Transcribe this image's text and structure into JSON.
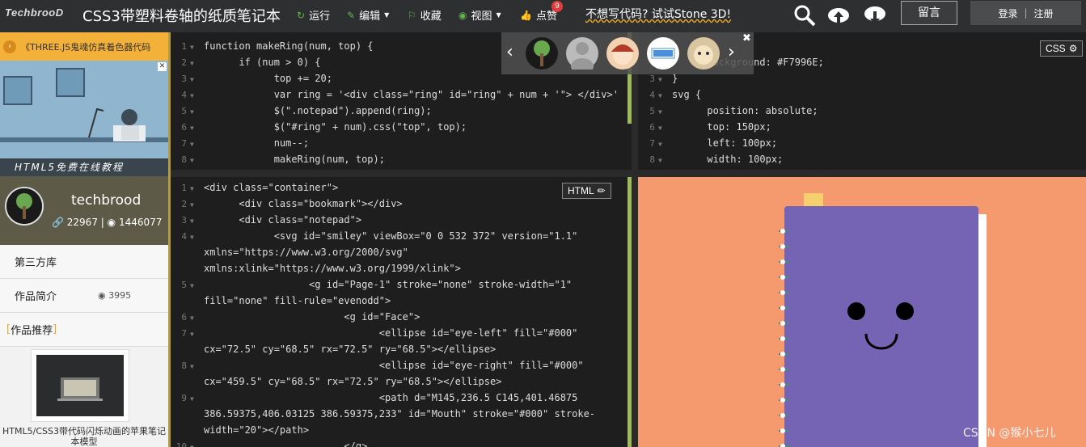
{
  "header": {
    "logo": "TechbrooD",
    "title": "CSS3带塑料卷轴的纸质笔记本",
    "run_label": "运行",
    "edit_label": "编辑",
    "collect_label": "收藏",
    "view_label": "视图",
    "like_label": "点赞",
    "like_count": "9",
    "promo_text": "不想写代码? 试试Stone 3D!",
    "message_label": "留言",
    "login_label": "登录",
    "register_label": "注册",
    "icons": [
      "search-icon",
      "cloud-upload-icon",
      "cloud-download-icon"
    ]
  },
  "sidebar": {
    "ad_strip_text": "《THREE.JS鬼魂仿真着色器代码",
    "ad_banner_text": "HTML5免费在线教程",
    "profile": {
      "name": "techbrood",
      "links": "22967",
      "views": "1446077"
    },
    "menu": [
      {
        "label": "第三方库"
      },
      {
        "label": "作品简介",
        "count": "3995"
      },
      {
        "label": "作品推荐"
      }
    ],
    "recommend_caption": "HTML5/CSS3带代码闪烁动画的苹果笔记本模型"
  },
  "editors": {
    "js": {
      "lines": [
        "1",
        "2",
        "3",
        "4",
        "5",
        "6",
        "7",
        "8"
      ],
      "code": [
        "function makeRing(num, top) {",
        "      if (num > 0) {",
        "            top += 20;",
        "            var ring = '<div class=\"ring\" id=\"ring\" + num + '\"> </div>'",
        "            $(\".notepad\").append(ring);",
        "            $(\"#ring\" + num).css(\"top\", top);",
        "            num--;",
        "            makeRing(num, top);"
      ]
    },
    "css": {
      "label": "CSS",
      "lines": [
        "2",
        "3",
        "4",
        "5",
        "6",
        "7",
        "8"
      ],
      "code": [
        "      background: #F7996E;",
        "}",
        "svg {",
        "      position: absolute;",
        "      top: 150px;",
        "      left: 100px;",
        "      width: 100px;"
      ]
    },
    "html": {
      "label": "HTML",
      "lines": [
        "1",
        "2",
        "3",
        "4",
        "",
        "",
        "5",
        "",
        "6",
        "7",
        "",
        "8",
        "",
        "9",
        "",
        "",
        "10"
      ],
      "code": [
        "<div class=\"container\">",
        "      <div class=\"bookmark\"></div>",
        "      <div class=\"notepad\">",
        "            <svg id=\"smiley\" viewBox=\"0 0 532 372\" version=\"1.1\"",
        "xmlns=\"https://www.w3.org/2000/svg\"",
        "xmlns:xlink=\"https://www.w3.org/1999/xlink\">",
        "                  <g id=\"Page-1\" stroke=\"none\" stroke-width=\"1\"",
        "fill=\"none\" fill-rule=\"evenodd\">",
        "                        <g id=\"Face\">",
        "                              <ellipse id=\"eye-left\" fill=\"#000\"",
        "cx=\"72.5\" cy=\"68.5\" rx=\"72.5\" ry=\"68.5\"></ellipse>",
        "                              <ellipse id=\"eye-right\" fill=\"#000\"",
        "cx=\"459.5\" cy=\"68.5\" rx=\"72.5\" ry=\"68.5\"></ellipse>",
        "                              <path d=\"M145,236.5 C145,401.46875",
        "386.59375,406.03125 386.59375,233\" id=\"Mouth\" stroke=\"#000\" stroke-",
        "width=\"20\"></path>",
        "                        </g>"
      ]
    }
  },
  "watermark": "CSDN @猴小七儿",
  "colors": {
    "preview_bg": "#f5996e",
    "notepad": "#7563b4",
    "bookmark": "#f7d06e",
    "accent_green": "#9fba5a"
  }
}
